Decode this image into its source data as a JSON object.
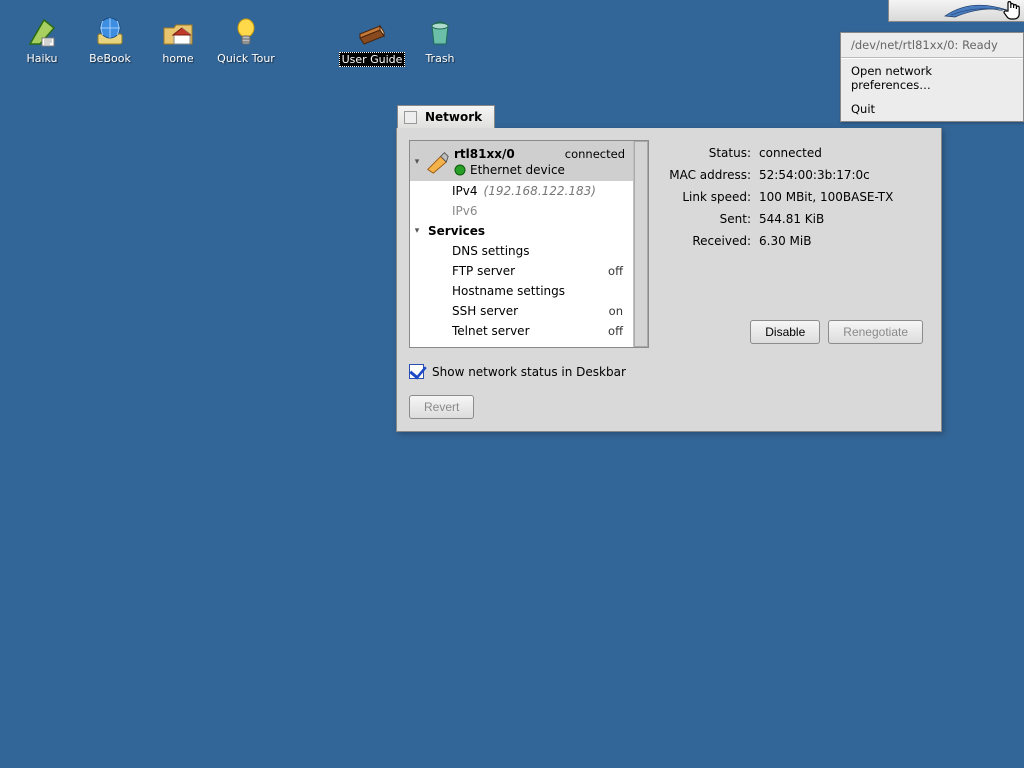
{
  "desktop": {
    "icons": [
      {
        "id": "haiku",
        "label": "Haiku",
        "selected": false
      },
      {
        "id": "bebook",
        "label": "BeBook",
        "selected": false
      },
      {
        "id": "home",
        "label": "home",
        "selected": false
      },
      {
        "id": "quick-tour",
        "label": "Quick Tour",
        "selected": false
      },
      {
        "id": "user-guide",
        "label": "User Guide",
        "selected": true
      },
      {
        "id": "trash",
        "label": "Trash",
        "selected": false
      }
    ]
  },
  "context_menu": {
    "header": "/dev/net/rtl81xx/0: Ready",
    "open_prefs": "Open network preferences…",
    "quit": "Quit"
  },
  "window": {
    "title": "Network",
    "checkbox_label": "Show network status in Deskbar",
    "revert": "Revert",
    "disable": "Disable",
    "renegotiate": "Renegotiate"
  },
  "interface": {
    "name": "rtl81xx/0",
    "type": "Ethernet device",
    "status": "connected"
  },
  "tree": {
    "ipv4_label": "IPv4",
    "ipv4_addr": "(192.168.122.183)",
    "ipv6_label": "IPv6",
    "services_label": "Services",
    "dns": {
      "label": "DNS settings"
    },
    "ftp": {
      "label": "FTP server",
      "state": "off"
    },
    "host": {
      "label": "Hostname settings"
    },
    "ssh": {
      "label": "SSH server",
      "state": "on"
    },
    "telnet": {
      "label": "Telnet server",
      "state": "off"
    }
  },
  "details": {
    "status_label": "Status:",
    "status_value": "connected",
    "mac_label": "MAC address:",
    "mac_value": "52:54:00:3b:17:0c",
    "link_label": "Link speed:",
    "link_value": "100 MBit, 100BASE-TX",
    "sent_label": "Sent:",
    "sent_value": "544.81 KiB",
    "recv_label": "Received:",
    "recv_value": "6.30 MiB"
  }
}
